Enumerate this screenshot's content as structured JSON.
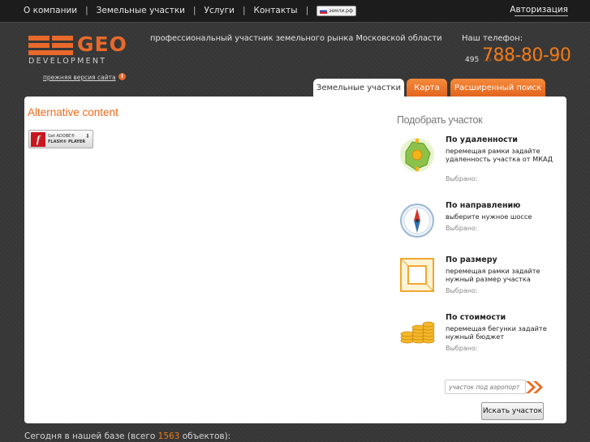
{
  "nav": {
    "items": [
      "О компании",
      "Земельные участки",
      "Услуги",
      "Контакты"
    ],
    "separator": "|",
    "domain_badge": "земли.рф",
    "auth": "Авторизация"
  },
  "logo": {
    "text": "GEO",
    "subtext": "DEVELOPMENT",
    "old_version_link": "прежняя версия сайта",
    "old_version_icon": "!"
  },
  "header": {
    "tagline": "профессиональный участник земельного рынка Московской области",
    "phone_label": "Наш телефон:",
    "phone_code": "495",
    "phone_number": "788-80-90"
  },
  "tabs": [
    {
      "label": "Земельные участки",
      "active": true
    },
    {
      "label": "Карта",
      "active": false
    },
    {
      "label": "Расширенный поиск",
      "active": false
    }
  ],
  "content": {
    "alt_title": "Alternative content",
    "flash_button": {
      "line1": "Get ADOBE®",
      "line2": "FLASH® PLAYER",
      "icon": "f"
    }
  },
  "picker": {
    "title": "Подобрать участок",
    "options": [
      {
        "title": "По удаленности",
        "desc": "перемещая рамки задайте удаленность участка от МКАД",
        "selected_label": "Выбрано:",
        "icon": "distance-map-icon"
      },
      {
        "title": "По направлению",
        "desc": "выберите нужное шоссе",
        "selected_label": "Выбрано:",
        "icon": "compass-icon"
      },
      {
        "title": "По размеру",
        "desc": "перемещая рамки задайте нужный размер участка",
        "selected_label": "Выбрано:",
        "icon": "size-frame-icon"
      },
      {
        "title": "По стоимости",
        "desc": "перемещая бегунки задайте нужный бюджет",
        "selected_label": "Выбрано:",
        "icon": "coins-icon"
      }
    ],
    "search_placeholder": "участок под аэропорт",
    "search_button": "Искать участок"
  },
  "footer": {
    "prefix": "Сегодня в нашей базе (всего ",
    "count": "1563",
    "suffix": " объектов):"
  },
  "colors": {
    "accent": "#f07a1a",
    "logo": "#e8692a",
    "alt_title": "#ef6a1d"
  }
}
